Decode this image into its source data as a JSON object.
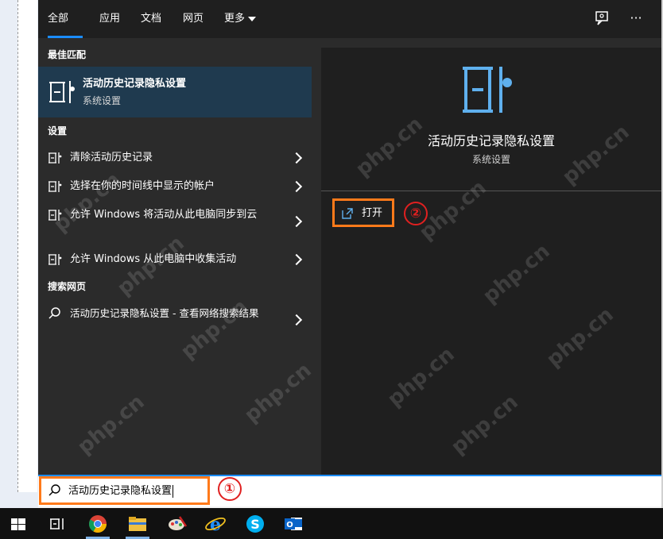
{
  "tabs": [
    {
      "label": "全部"
    },
    {
      "label": "应用"
    },
    {
      "label": "文档"
    },
    {
      "label": "网页"
    },
    {
      "label": "更多"
    }
  ],
  "top_icons": {
    "feedback": "feedback-icon",
    "more": "···"
  },
  "best_match": {
    "heading": "最佳匹配",
    "title": "活动历史记录隐私设置",
    "subtitle": "系统设置"
  },
  "settings": {
    "heading": "设置",
    "items": [
      {
        "label": "清除活动历史记录"
      },
      {
        "label": "选择在你的时间线中显示的帐户"
      },
      {
        "label": "允许 Windows 将活动从此电脑同步到云"
      },
      {
        "label": "允许 Windows 从此电脑中收集活动"
      }
    ]
  },
  "web": {
    "heading": "搜索网页",
    "item": {
      "label": "活动历史记录隐私设置 - 查看网络搜索结果"
    }
  },
  "preview": {
    "title": "活动历史记录隐私设置",
    "subtitle": "系统设置",
    "open_label": "打开"
  },
  "annotations": {
    "one": "①",
    "two": "②"
  },
  "search": {
    "value": "活动历史记录隐私设置"
  },
  "watermark": "php.cn",
  "colors": {
    "accent": "#1a8cff",
    "highlight": "#ff7a1a",
    "marker": "#e02020",
    "selected_bg": "#1f3a4f"
  }
}
